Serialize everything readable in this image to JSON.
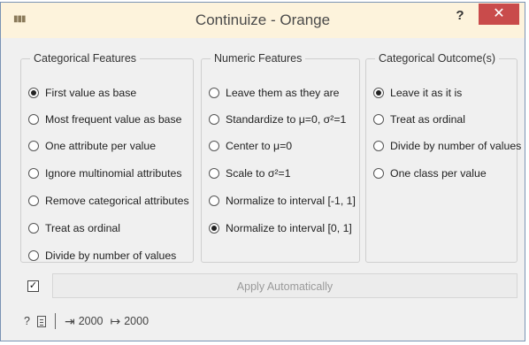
{
  "window": {
    "title": "Continuize - Orange",
    "help_label": "?",
    "close_label": "✕",
    "app_icon_glyph": "▮▮▮"
  },
  "categorical_features": {
    "label": "Categorical Features",
    "options": [
      {
        "label": "First value as base",
        "selected": true
      },
      {
        "label": "Most frequent value as base",
        "selected": false
      },
      {
        "label": "One attribute per value",
        "selected": false
      },
      {
        "label": "Ignore multinomial attributes",
        "selected": false
      },
      {
        "label": "Remove categorical attributes",
        "selected": false
      },
      {
        "label": "Treat as ordinal",
        "selected": false
      },
      {
        "label": "Divide by number of values",
        "selected": false
      }
    ]
  },
  "numeric_features": {
    "label": "Numeric Features",
    "options": [
      {
        "label": "Leave them as they are",
        "selected": false
      },
      {
        "label": "Standardize to μ=0, σ²=1",
        "selected": false
      },
      {
        "label": "Center to μ=0",
        "selected": false
      },
      {
        "label": "Scale to σ²=1",
        "selected": false
      },
      {
        "label": "Normalize to interval [-1, 1]",
        "selected": false
      },
      {
        "label": "Normalize to interval [0, 1]",
        "selected": true
      }
    ]
  },
  "categorical_outcome": {
    "label": "Categorical Outcome(s)",
    "options": [
      {
        "label": "Leave it as it is",
        "selected": true
      },
      {
        "label": "Treat as ordinal",
        "selected": false
      },
      {
        "label": "Divide by number of values",
        "selected": false
      },
      {
        "label": "One class per value",
        "selected": false
      }
    ]
  },
  "apply": {
    "label": "Apply Automatically",
    "checked": true,
    "check_glyph": "✓"
  },
  "status": {
    "help_glyph": "?",
    "input_count": "2000",
    "output_count": "2000",
    "input_glyph": "⇥",
    "output_glyph": "↦"
  }
}
